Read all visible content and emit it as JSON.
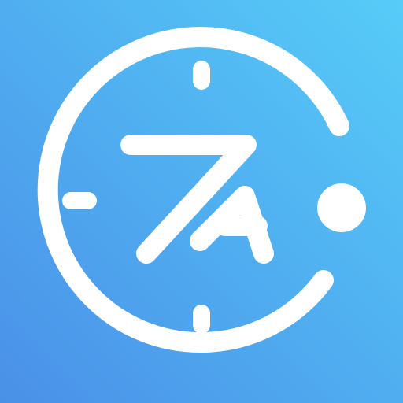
{
  "icon": {
    "name": "clock-logo-icon",
    "logo_lettering": "7A",
    "colors": {
      "gradient_top_right": "#56CCF8",
      "gradient_bottom_left": "#4A90E8",
      "foreground": "#FFFFFF"
    }
  }
}
